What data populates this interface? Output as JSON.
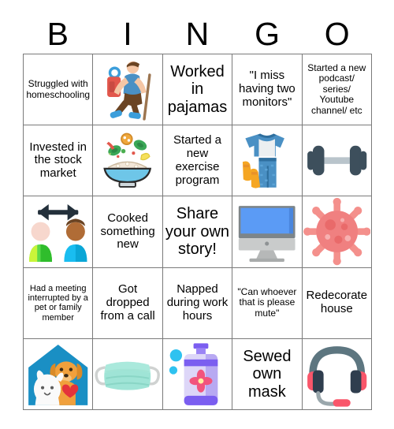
{
  "header": {
    "letters": [
      "B",
      "I",
      "N",
      "G",
      "O"
    ]
  },
  "colors": {
    "grid_line": "#7a7a7a",
    "text": "#000000",
    "background": "#ffffff",
    "hiker_shirt": "#4a90c4",
    "hiker_pants": "#6b4423",
    "hiker_backpack": "#e2574c",
    "hiker_skin": "#f5c6a5",
    "hiker_boots": "#3b9edb",
    "bowl_blue": "#6ec6e8",
    "bowl_rice": "#f2e6d8",
    "leaf_green": "#3aa757",
    "pajama_blue": "#4a90c4",
    "pajama_shirt": "#eceff1",
    "sock_yellow": "#f5a623",
    "dumbbell_dark": "#3d4f5c",
    "dumbbell_bar": "#b9c4cb",
    "person_a_body": "#5ad94a",
    "person_a_skin": "#f7d7cd",
    "person_b_body": "#19bdf0",
    "person_b_skin": "#b06c36",
    "arrow_dark": "#23303b",
    "monitor_screen": "#5b9bf5",
    "monitor_body": "#c9cbcb",
    "virus_body": "#f08080",
    "virus_spike": "#f4908c",
    "pet_house_blue": "#1a8fc4",
    "dog_orange": "#f0a03c",
    "cat_white": "#fafafa",
    "heart_red": "#e4333b",
    "mask_teal": "#9fe4d6",
    "soap_purple": "#8a6ff0",
    "soap_bottle": "#ddd6f8",
    "soap_flower": "#f2547d",
    "headset_band": "#5d7680",
    "headset_cup": "#2f3e4e",
    "headset_accent": "#f9566a"
  },
  "grid": {
    "rows": [
      [
        {
          "type": "text",
          "text": "Struggled with homeschooling",
          "size": "fs-sm",
          "name": "cell-b1"
        },
        {
          "type": "art",
          "art": "hiker-icon",
          "name": "cell-i1"
        },
        {
          "type": "text",
          "text": "Worked in pajamas",
          "size": "fs-xl",
          "name": "cell-n1"
        },
        {
          "type": "text",
          "text": "\"I miss having two monitors\"",
          "size": "fs-md",
          "name": "cell-g1"
        },
        {
          "type": "text",
          "text": "Started a new podcast/ series/ Youtube channel/ etc",
          "size": "fs-sm",
          "name": "cell-o1"
        }
      ],
      [
        {
          "type": "text",
          "text": "Invested in the stock market",
          "size": "fs-md",
          "name": "cell-b2"
        },
        {
          "type": "art",
          "art": "salad-bowl-icon",
          "name": "cell-i2"
        },
        {
          "type": "text",
          "text": "Started a new exercise program",
          "size": "fs-md",
          "name": "cell-n2"
        },
        {
          "type": "art",
          "art": "pajamas-icon",
          "name": "cell-g2"
        },
        {
          "type": "art",
          "art": "dumbbell-icon",
          "name": "cell-o2"
        }
      ],
      [
        {
          "type": "art",
          "art": "social-distancing-icon",
          "name": "cell-b3"
        },
        {
          "type": "text",
          "text": "Cooked something new",
          "size": "fs-md",
          "name": "cell-i3"
        },
        {
          "type": "text",
          "text": "Share your own story!",
          "size": "fs-xl",
          "name": "cell-n3-free-space"
        },
        {
          "type": "art",
          "art": "desktop-computer-icon",
          "name": "cell-g3"
        },
        {
          "type": "art",
          "art": "virus-icon",
          "name": "cell-o3"
        }
      ],
      [
        {
          "type": "text",
          "text": "Had a meeting interrupted by a pet or family member",
          "size": "fs-xs",
          "name": "cell-b4"
        },
        {
          "type": "text",
          "text": "Got dropped from a call",
          "size": "fs-md",
          "name": "cell-i4"
        },
        {
          "type": "text",
          "text": "Napped during work hours",
          "size": "fs-md",
          "name": "cell-n4"
        },
        {
          "type": "text",
          "text": "\"Can whoever that is please mute\"",
          "size": "fs-sm",
          "name": "cell-g4"
        },
        {
          "type": "text",
          "text": "Redecorate house",
          "size": "fs-md",
          "name": "cell-o4"
        }
      ],
      [
        {
          "type": "art",
          "art": "pet-house-icon",
          "name": "cell-b5"
        },
        {
          "type": "art",
          "art": "face-mask-icon",
          "name": "cell-i5"
        },
        {
          "type": "art",
          "art": "soap-bottle-icon",
          "name": "cell-n5"
        },
        {
          "type": "text",
          "text": "Sewed own mask",
          "size": "fs-xl",
          "name": "cell-g5"
        },
        {
          "type": "art",
          "art": "headset-icon",
          "name": "cell-o5"
        }
      ]
    ]
  }
}
